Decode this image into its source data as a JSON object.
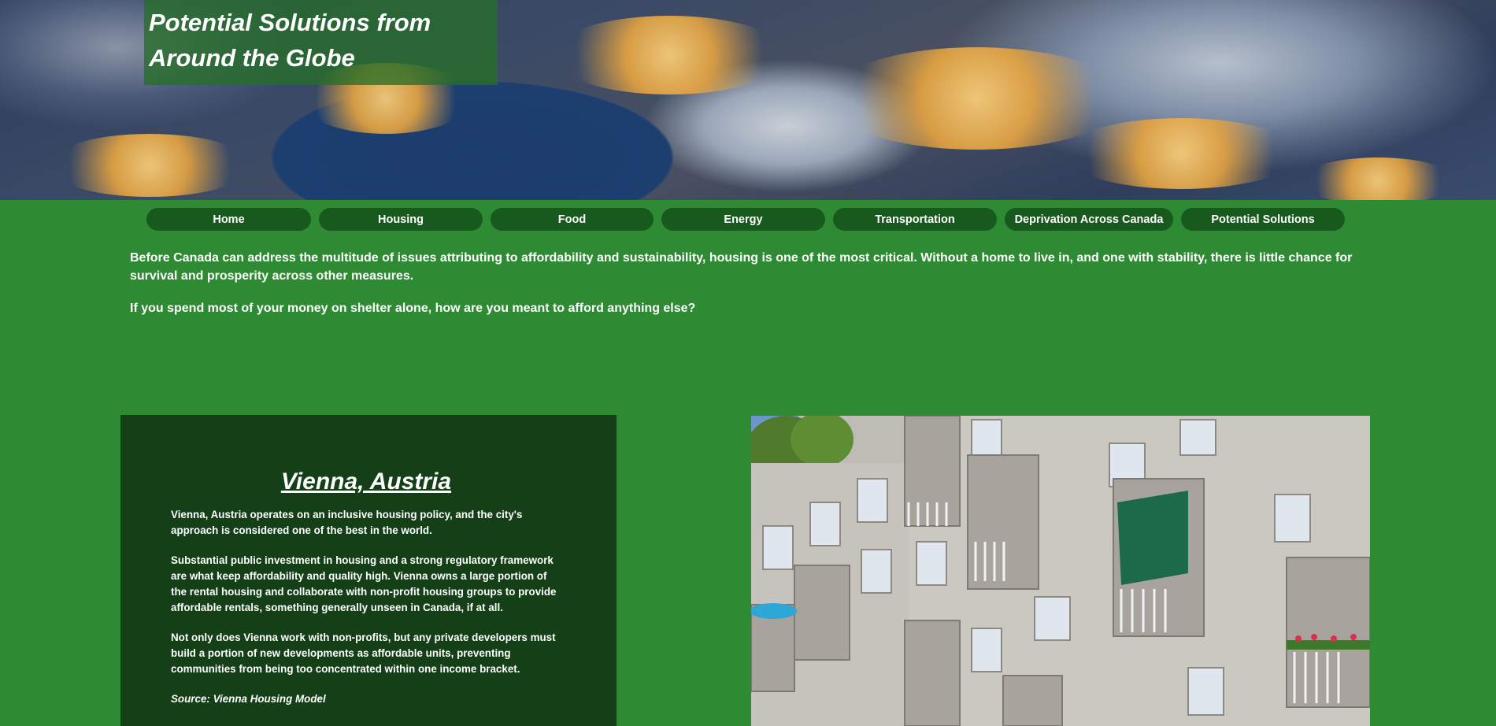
{
  "header": {
    "title_line1": "Potential Solutions from",
    "title_line2": "Around the Globe"
  },
  "nav": {
    "items": [
      {
        "label": "Home"
      },
      {
        "label": "Housing"
      },
      {
        "label": "Food"
      },
      {
        "label": "Energy"
      },
      {
        "label": "Transportation"
      },
      {
        "label": "Deprivation Across Canada"
      },
      {
        "label": "Potential Solutions"
      }
    ]
  },
  "intro": {
    "paragraph1": "Before Canada can address the multitude of issues attributing to affordability and sustainability, housing is one of the most critical. Without a home to live in, and one with stability, there is little chance for survival and prosperity across other measures.",
    "paragraph2": "If you spend most of your money on shelter alone, how are you meant to afford anything else?"
  },
  "vienna": {
    "heading": "Vienna, Austria",
    "paragraph1": "Vienna, Austria operates on an inclusive housing policy, and the city's approach is considered one of the best in the world.",
    "paragraph2": "Substantial public investment in housing and a strong regulatory framework are what keep affordability and quality high. Vienna owns a large portion of the rental housing and collaborate with non-profit housing groups to provide affordable rentals, something generally unseen in Canada, if at all.",
    "paragraph3": "Not only does Vienna work with non-profits, but any private developers must build a portion of new developments as affordable units, preventing communities from being too concentrated within one income bracket.",
    "source": "Source: Vienna Housing Model"
  },
  "colors": {
    "page_background": "#2e8b34",
    "nav_button": "#185a1d",
    "card_background": "#143f17",
    "title_box": "#266e28"
  }
}
